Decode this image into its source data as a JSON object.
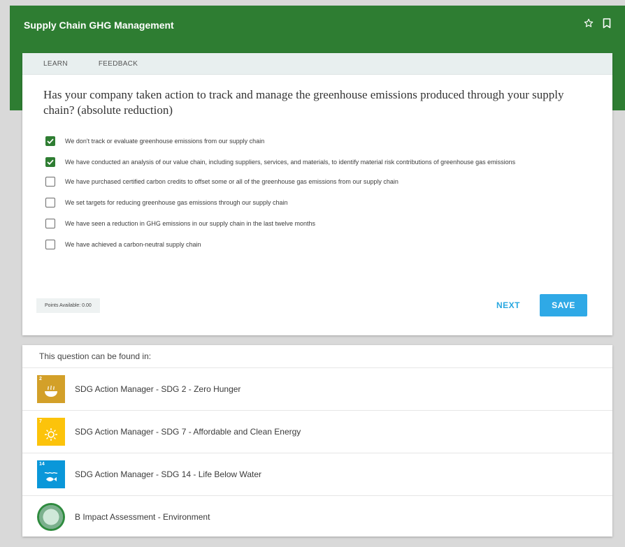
{
  "header": {
    "title": "Supply Chain GHG Management",
    "color": "#2e7d32"
  },
  "tabs": [
    {
      "label": "LEARN"
    },
    {
      "label": "FEEDBACK"
    }
  ],
  "question": {
    "text": "Has your company taken action to track and manage the greenhouse emissions produced through your supply chain? (absolute reduction)"
  },
  "options": [
    {
      "label": "We don't track or evaluate greenhouse emissions from our supply chain",
      "checked": true
    },
    {
      "label": "We have conducted an analysis of our value chain, including suppliers, services, and materials, to identify material risk contributions of greenhouse gas emissions",
      "checked": true
    },
    {
      "label": "We have purchased certified carbon credits to offset some or all of the greenhouse gas emissions from our supply chain",
      "checked": false
    },
    {
      "label": "We set targets for reducing greenhouse gas emissions through our supply chain",
      "checked": false
    },
    {
      "label": "We have seen a reduction in GHG emissions in our supply chain in the last twelve months",
      "checked": false
    },
    {
      "label": "We have achieved a carbon-neutral supply chain",
      "checked": false
    }
  ],
  "footer": {
    "points": "Points Available: 0.00",
    "next_label": "NEXT",
    "save_label": "SAVE"
  },
  "found_in": {
    "header": "This question can be found in:",
    "items": [
      {
        "label": "SDG Action Manager - SDG 2 - Zero Hunger",
        "badge_number": "2",
        "badge_color": "#d3a029",
        "icon": "bowl-icon"
      },
      {
        "label": "SDG Action Manager - SDG 7 - Affordable and Clean Energy",
        "badge_number": "7",
        "badge_color": "#fcc30b",
        "icon": "sun-icon"
      },
      {
        "label": "SDG Action Manager - SDG 14 - Life Below Water",
        "badge_number": "14",
        "badge_color": "#0a97d9",
        "icon": "fish-icon"
      },
      {
        "label": "B Impact Assessment - Environment",
        "icon": "globe-icon"
      }
    ]
  }
}
